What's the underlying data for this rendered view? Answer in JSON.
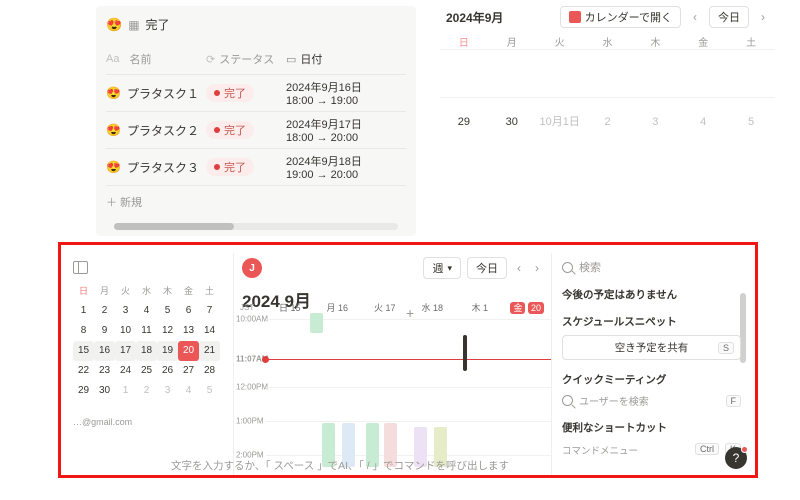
{
  "left_table": {
    "icon": "😍",
    "grid_glyph": "▦",
    "title": "完了",
    "columns": {
      "name": "名前",
      "status": "ステータス",
      "date": "日付",
      "name_prefix": "Aa",
      "status_icon": "⟳",
      "date_icon": "▭"
    },
    "rows": [
      {
        "emoji": "😍",
        "name": "プラタスク１",
        "status": "完了",
        "date_l1": "2024年9月16日",
        "date_l2": "18:00 → 19:00"
      },
      {
        "emoji": "😍",
        "name": "プラタスク２",
        "status": "完了",
        "date_l1": "2024年9月17日",
        "date_l2": "18:00 → 20:00"
      },
      {
        "emoji": "😍",
        "name": "プラタスク３",
        "status": "完了",
        "date_l1": "2024年9月18日",
        "date_l2": "19:00 → 20:00"
      }
    ],
    "new_row": "＋ 新規"
  },
  "right_cal": {
    "month": "2024年9月",
    "open_btn": "カレンダーで開く",
    "today_btn": "今日",
    "dow": [
      "日",
      "月",
      "火",
      "水",
      "木",
      "金",
      "土"
    ],
    "cells": [
      "29",
      "30",
      "10月1日",
      "2",
      "3",
      "4",
      "5"
    ]
  },
  "big": {
    "avatar": "J",
    "view_btn": "週",
    "today_btn": "今日",
    "title": "2024 9月",
    "jst": "JST",
    "days": [
      "日 15",
      "月 16",
      "火 17",
      "水 18",
      "木 1",
      "金",
      "20"
    ],
    "time_labels": {
      "ten": "10:00AM",
      "now": "11:07AM",
      "twelve": "12:00PM",
      "one": "1:00PM",
      "two": "2:00PM"
    },
    "mini": {
      "dow": [
        "日",
        "月",
        "火",
        "水",
        "木",
        "金",
        "土"
      ],
      "weeks": [
        [
          "1",
          "2",
          "3",
          "4",
          "5",
          "6",
          "7"
        ],
        [
          "8",
          "9",
          "10",
          "11",
          "12",
          "13",
          "14"
        ],
        [
          "15",
          "16",
          "17",
          "18",
          "19",
          "20",
          "21"
        ],
        [
          "22",
          "23",
          "24",
          "25",
          "26",
          "27",
          "28"
        ],
        [
          "29",
          "30",
          "1",
          "2",
          "3",
          "4",
          "5"
        ]
      ],
      "mail": "…@gmail.com"
    },
    "rside": {
      "search_placeholder": "検索",
      "no_upcoming": "今後の予定はありません",
      "snippet_h": "スケジュールスニペット",
      "share_btn": "空き予定を共有",
      "share_kbd": "S",
      "quick_h": "クイックミーティング",
      "user_search": "ユーザーを検索",
      "user_kbd": "F",
      "shortcut_h": "便利なショートカット",
      "shortcut_sub": "コマンドメニュー",
      "ctrl": "Ctrl",
      "k": "K"
    },
    "hint": "文字を入力するか、「 スペース 」でAI、「 / 」でコマンドを呼び出します"
  }
}
